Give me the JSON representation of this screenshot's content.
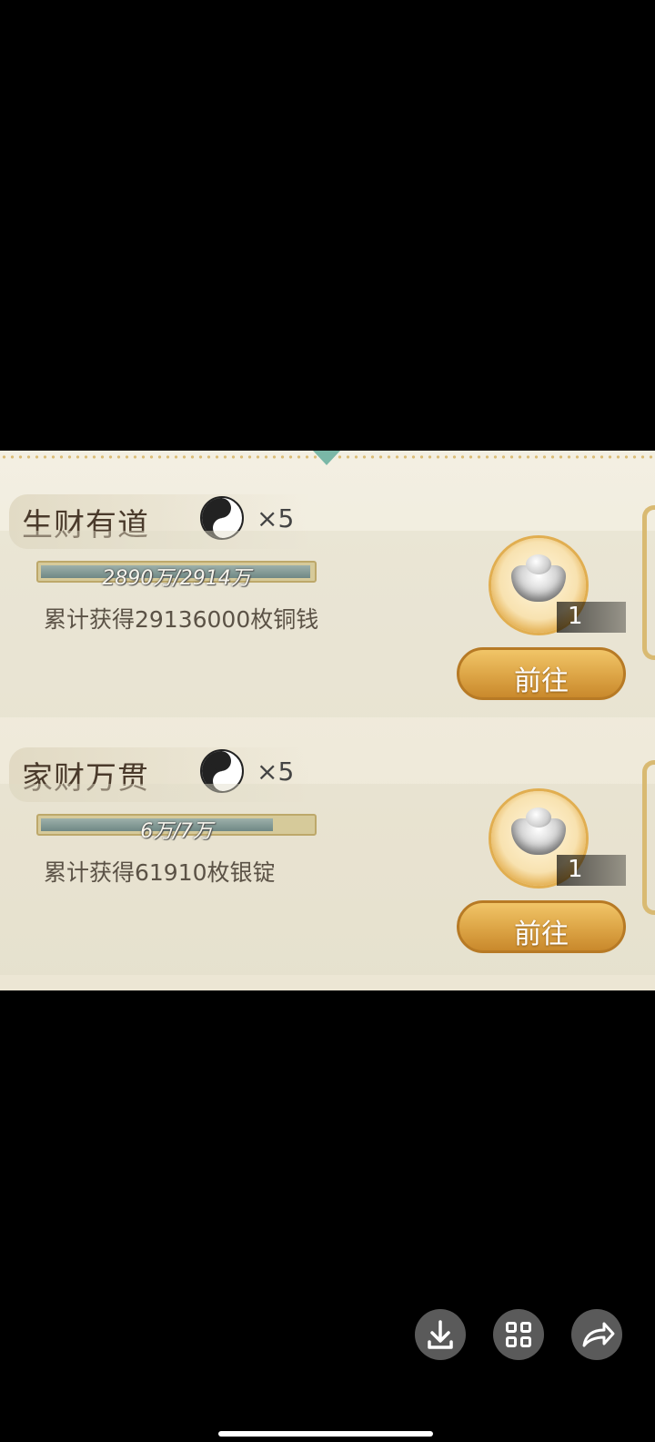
{
  "tasks": [
    {
      "title": "生财有道",
      "reward_icon": "yin-yang-token-icon",
      "reward_qty": "×5",
      "progress": {
        "text": "2890万/2914万",
        "fraction": 0.9918
      },
      "description": "累计获得29136000枚铜钱",
      "item_icon": "silver-ingot-icon",
      "item_count": "1",
      "go_label": "前往"
    },
    {
      "title": "家财万贯",
      "reward_icon": "yin-yang-token-icon",
      "reward_qty": "×5",
      "progress": {
        "text": "6万/7万",
        "fraction": 0.8571
      },
      "description": "累计获得61910枚银锭",
      "item_icon": "silver-ingot-icon",
      "item_count": "1",
      "go_label": "前往"
    }
  ],
  "floating_buttons": [
    {
      "icon": "download-icon"
    },
    {
      "icon": "grid-apps-icon"
    },
    {
      "icon": "share-forward-icon"
    }
  ],
  "colors": {
    "panel_bg": "#f3efe2",
    "gold": "#dca445",
    "progress_fill": "#6f8885"
  }
}
